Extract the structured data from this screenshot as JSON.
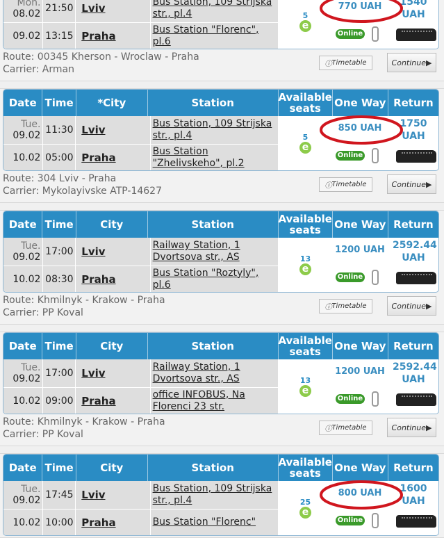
{
  "headers": {
    "date": "Date",
    "time": "Time",
    "city": "City",
    "city_sorted": "*City",
    "station": "Station",
    "seats": "Available seats",
    "one_way": "One Way",
    "return": "Return"
  },
  "labels": {
    "timetable": "Timetable",
    "continue": "Continue",
    "online": "Online",
    "e": "e"
  },
  "colors": {
    "header": "#2a8cc4",
    "price": "#3a8ec0",
    "online": "#3a9a2a",
    "annotation": "#d0161e"
  },
  "trips": [
    {
      "show_header": false,
      "dep": {
        "dow": "Mon.",
        "date": "08.02",
        "time": "21:50",
        "city": "Lviv",
        "station": "Bus Station, 109 Strijska str., pl.4"
      },
      "arr": {
        "date": "09.02",
        "time": "13:15",
        "city": "Praha",
        "station": "Bus Station \"Florenc\", pl.6"
      },
      "seats": "5",
      "one_way": "770 UAH",
      "return": "1540 UAH",
      "circled": true,
      "route": "Route: 00345 Kherson - Wroclaw - Praha",
      "carrier": "Carrier: Arman"
    },
    {
      "show_header": true,
      "city_header": "*City",
      "dep": {
        "dow": "Tue.",
        "date": "09.02",
        "time": "11:30",
        "city": "Lviv",
        "station": "Bus Station, 109 Strijska str., pl.4"
      },
      "arr": {
        "date": "10.02",
        "time": "05:00",
        "city": "Praha",
        "station": "Bus Station \"Zhelivskeho\", pl.2"
      },
      "seats": "5",
      "one_way": "850 UAH",
      "return": "1750 UAH",
      "circled": true,
      "route": "Route: 304 Lviv - Praha",
      "carrier": "Carrier: Mykolayivske ATP-14627"
    },
    {
      "show_header": true,
      "city_header": "City",
      "dep": {
        "dow": "Tue.",
        "date": "09.02",
        "time": "17:00",
        "city": "Lviv",
        "station": "Railway Station, 1 Dvortsova str., AS"
      },
      "arr": {
        "date": "10.02",
        "time": "08:30",
        "city": "Praha",
        "station": "Bus Station \"Roztyly\", pl.6"
      },
      "seats": "13",
      "one_way": "1200 UAH",
      "return": "2592.44 UAH",
      "circled": false,
      "route": "Route: Khmilnyk - Krakow - Praha",
      "carrier": "Carrier: PP Koval"
    },
    {
      "show_header": true,
      "city_header": "City",
      "dep": {
        "dow": "Tue.",
        "date": "09.02",
        "time": "17:00",
        "city": "Lviv",
        "station": "Railway Station, 1 Dvortsova str., AS"
      },
      "arr": {
        "date": "10.02",
        "time": "09:00",
        "city": "Praha",
        "station": "office INFOBUS, Na Florenci 23 str."
      },
      "seats": "13",
      "one_way": "1200 UAH",
      "return": "2592.44 UAH",
      "circled": false,
      "route": "Route: Khmilnyk - Krakow - Praha",
      "carrier": "Carrier: PP Koval"
    },
    {
      "show_header": true,
      "city_header": "City",
      "dep": {
        "dow": "Tue.",
        "date": "09.02",
        "time": "17:45",
        "city": "Lviv",
        "station": "Bus Station, 109 Strijska str., pl.4"
      },
      "arr": {
        "date": "10.02",
        "time": "10:00",
        "city": "Praha",
        "station": "Bus Station \"Florenc\""
      },
      "seats": "25",
      "one_way": "800 UAH",
      "return": "1600 UAH",
      "circled": true
    }
  ]
}
